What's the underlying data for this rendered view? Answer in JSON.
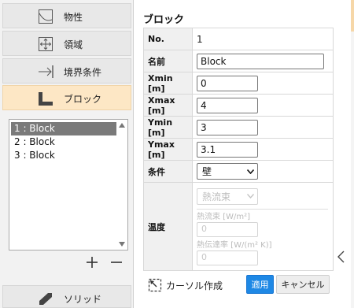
{
  "nav": {
    "items": [
      {
        "label": "物性",
        "icon": "material-icon"
      },
      {
        "label": "領域",
        "icon": "domain-icon"
      },
      {
        "label": "境界条件",
        "icon": "boundary-arrow-icon"
      },
      {
        "label": "ブロック",
        "icon": "block-icon",
        "active": true
      },
      {
        "label": "ソリッド",
        "icon": "solid-icon"
      }
    ]
  },
  "block_list": {
    "items": [
      "1 : Block",
      "2 : Block",
      "3 : Block"
    ],
    "selected_index": 0
  },
  "panel": {
    "title": "ブロック",
    "rows": {
      "no": {
        "label": "No.",
        "value": "1"
      },
      "name": {
        "label": "名前",
        "value": "Block"
      },
      "xmin": {
        "label": "Xmin [m]",
        "value": "0"
      },
      "xmax": {
        "label": "Xmax [m]",
        "value": "4"
      },
      "ymin": {
        "label": "Ymin [m]",
        "value": "3"
      },
      "ymax": {
        "label": "Ymax [m]",
        "value": "3.1"
      },
      "condition": {
        "label": "条件",
        "value": "壁"
      },
      "temperature": {
        "label": "温度",
        "mode_value": "熱流束",
        "heat_flux_label": "熱流束 [W/m²]",
        "heat_flux_value": "0",
        "htc_label": "熱伝達率 [W/(m² K)]",
        "htc_value": "0"
      }
    }
  },
  "footer": {
    "cursor_create_label": "カーソル作成",
    "apply_label": "適用",
    "cancel_label": "キャンセル"
  },
  "colors": {
    "accent": "#1e88e5",
    "active_nav": "#fde7c5",
    "selected_row": "#7a7a7a"
  }
}
